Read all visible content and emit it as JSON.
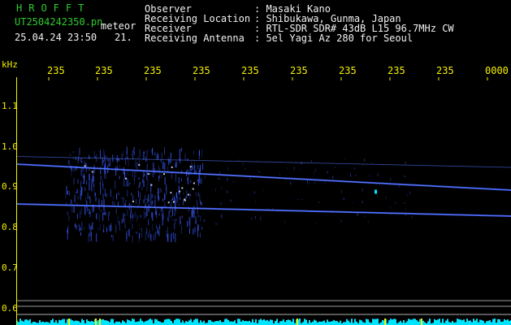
{
  "header": {
    "logo": "HROFFT",
    "filename": "UT2504242350.pn",
    "mode": "meteor",
    "datetime": "25.04.24 23:50",
    "counter": "21.",
    "fields": [
      {
        "label": "Observer",
        "value": ": Masaki Kano"
      },
      {
        "label": "Receiving Location",
        "value": ": Shibukawa, Gunma, Japan"
      },
      {
        "label": "Receiver",
        "value": ": RTL-SDR SDR# 43dB L15 96.7MHz CW"
      },
      {
        "label": "Receiving Antenna",
        "value": ": 5el Yagi Az 280 for Seoul"
      }
    ]
  },
  "axes": {
    "y_unit": "kHz",
    "x_ticks": [
      "235",
      "235",
      "235",
      "235",
      "235",
      "235",
      "235",
      "235",
      "235",
      "0000"
    ],
    "y_ticks": [
      "1.1",
      "1.0",
      "0.9",
      "0.8",
      "0.7",
      "0.6"
    ]
  },
  "colors": {
    "background": "#000000",
    "header_green": "#2ecc2e",
    "header_text": "#f2f2f2",
    "axis_yellow": "#f5f000",
    "echo_blue": "#3a5cff",
    "noise_cyan": "#00e5ff"
  },
  "spectrogram": {
    "traces": [
      {
        "freq_start": 0.966,
        "freq_end": 0.902
      },
      {
        "freq_start": 0.868,
        "freq_end": 0.838
      },
      {
        "freq_start": 0.985,
        "freq_end": 0.958
      }
    ],
    "burst_freq_range": [
      0.79,
      1.01
    ]
  }
}
